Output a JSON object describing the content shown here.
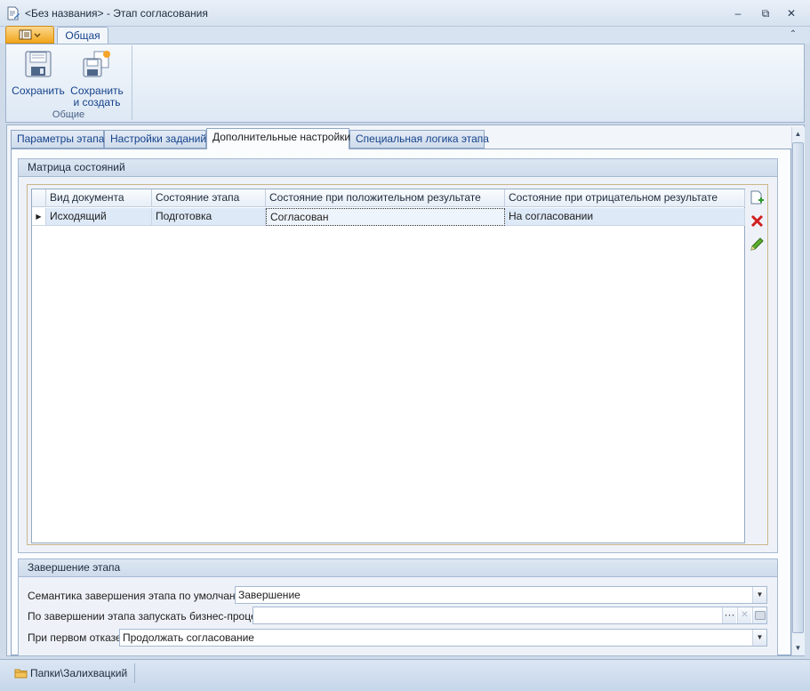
{
  "window": {
    "title": "<Без названия> - Этап согласования"
  },
  "ribbon": {
    "tab": "Общая",
    "save_label": "Сохранить",
    "save_create_line1": "Сохранить",
    "save_create_line2": "и создать",
    "group_label": "Общие"
  },
  "tabs": [
    {
      "label": "Параметры этапа"
    },
    {
      "label": "Настройки заданий"
    },
    {
      "label": "Дополнительные настройки"
    },
    {
      "label": "Специальная логика этапа"
    }
  ],
  "matrix": {
    "title": "Матрица состояний",
    "columns": [
      "Вид документа",
      "Состояние этапа",
      "Состояние при положительном результате",
      "Состояние при отрицательном результате"
    ],
    "rows": [
      [
        "Исходящий",
        "Подготовка",
        "Согласован",
        "На согласовании"
      ]
    ]
  },
  "completion": {
    "title": "Завершение этапа",
    "semantics_label": "Семантика завершения этапа по умолчанию:",
    "semantics_value": "Завершение",
    "process_label": "По завершении этапа запускать бизнес-процесс:",
    "process_value": "",
    "ellipsis": "···",
    "first_reject_label": "При первом отказе:",
    "first_reject_value": "Продолжать согласование"
  },
  "status": {
    "folder": "Папки\\Залихвацкий"
  },
  "colors": {
    "accent": "#15428b",
    "app_menu": "#f2a51c",
    "selected_row": "#dde9f7"
  }
}
